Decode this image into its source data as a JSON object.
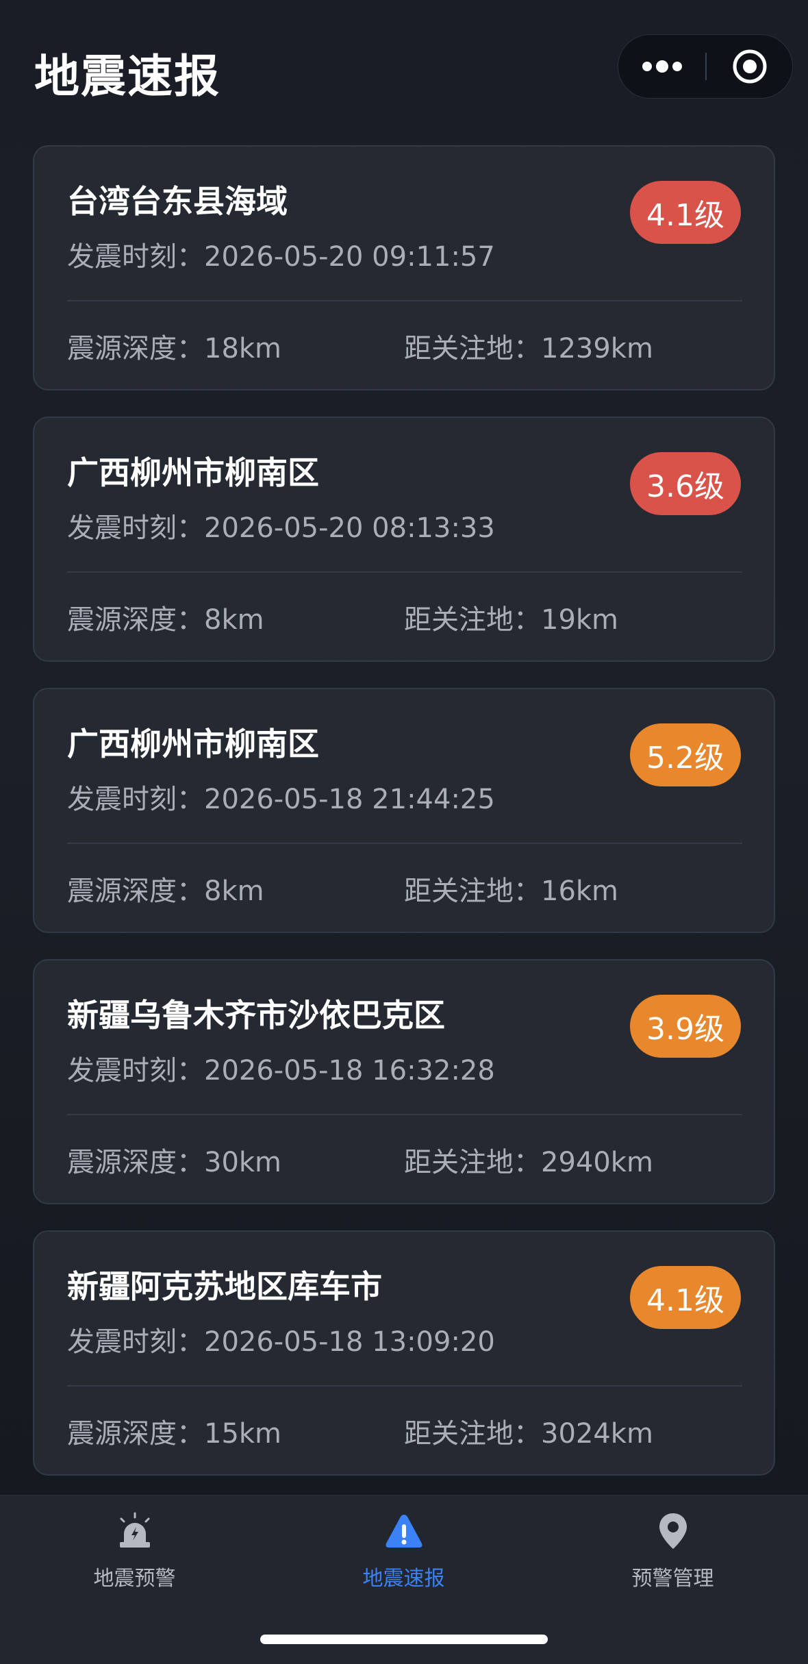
{
  "header": {
    "title": "地震速报"
  },
  "colors": {
    "badge_red": "#d9534a",
    "badge_orange": "#e8872b",
    "active_tab": "#3b82f6",
    "inactive_tab": "#b5b9c2"
  },
  "quakes": [
    {
      "location": "台湾台东县海域",
      "time": "发震时刻：2026-05-20 09:11:57",
      "magnitude": "4.1级",
      "depth": "震源深度：18km",
      "distance": "距关注地：1239km",
      "badge_color": "red"
    },
    {
      "location": "广西柳州市柳南区",
      "time": "发震时刻：2026-05-20 08:13:33",
      "magnitude": "3.6级",
      "depth": "震源深度：8km",
      "distance": "距关注地：19km",
      "badge_color": "red"
    },
    {
      "location": "广西柳州市柳南区",
      "time": "发震时刻：2026-05-18 21:44:25",
      "magnitude": "5.2级",
      "depth": "震源深度：8km",
      "distance": "距关注地：16km",
      "badge_color": "orange"
    },
    {
      "location": "新疆乌鲁木齐市沙依巴克区",
      "time": "发震时刻：2026-05-18 16:32:28",
      "magnitude": "3.9级",
      "depth": "震源深度：30km",
      "distance": "距关注地：2940km",
      "badge_color": "orange"
    },
    {
      "location": "新疆阿克苏地区库车市",
      "time": "发震时刻：2026-05-18 13:09:20",
      "magnitude": "4.1级",
      "depth": "震源深度：15km",
      "distance": "距关注地：3024km",
      "badge_color": "orange"
    }
  ],
  "tabs": [
    {
      "label": "地震预警",
      "icon": "alarm-siren-icon",
      "active": false
    },
    {
      "label": "地震速报",
      "icon": "warning-triangle-icon",
      "active": true
    },
    {
      "label": "预警管理",
      "icon": "location-pin-icon",
      "active": false
    }
  ]
}
